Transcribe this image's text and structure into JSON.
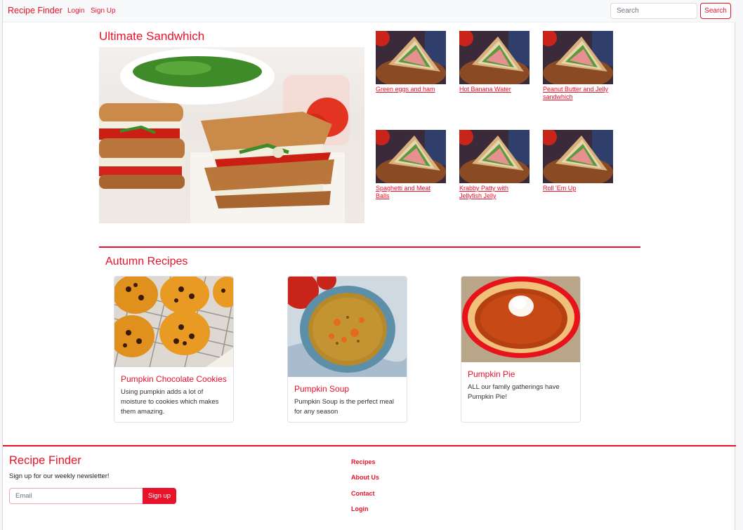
{
  "navbar": {
    "brand": "Recipe Finder",
    "links": [
      "Login",
      "Sign Up"
    ],
    "search_placeholder": "Search",
    "search_button": "Search"
  },
  "featured": {
    "title": "Ultimate Sandwhich",
    "thumbnails": [
      "Green eggs and ham",
      "Hot Banana Water",
      "Peanut Butter and Jelly sandwhich",
      "Spaghetti and Meat Balls",
      "Krabby Patty with Jellyfish Jelly",
      "Roll 'Em Up"
    ]
  },
  "autumn": {
    "title": "Autumn Recipes",
    "cards": [
      {
        "title": "Pumpkin Chocolate Cookies",
        "text": "Using pumpkin adds a lot of moisture to cookies which makes them amazing."
      },
      {
        "title": "Pumpkin Soup",
        "text": "Pumpkin Soup is the perfect meal for any season"
      },
      {
        "title": "Pumpkin Pie",
        "text": "ALL our family gatherings have Pumpkin Pie!"
      }
    ]
  },
  "footer": {
    "brand": "Recipe Finder",
    "newsletter_text": "Sign up for our weekly newsletter!",
    "email_placeholder": "Email",
    "signup_button": "Sign up",
    "links": [
      "Recipes",
      "About Us",
      "Contact",
      "Login"
    ]
  },
  "colors": {
    "accent": "#e8122a"
  }
}
